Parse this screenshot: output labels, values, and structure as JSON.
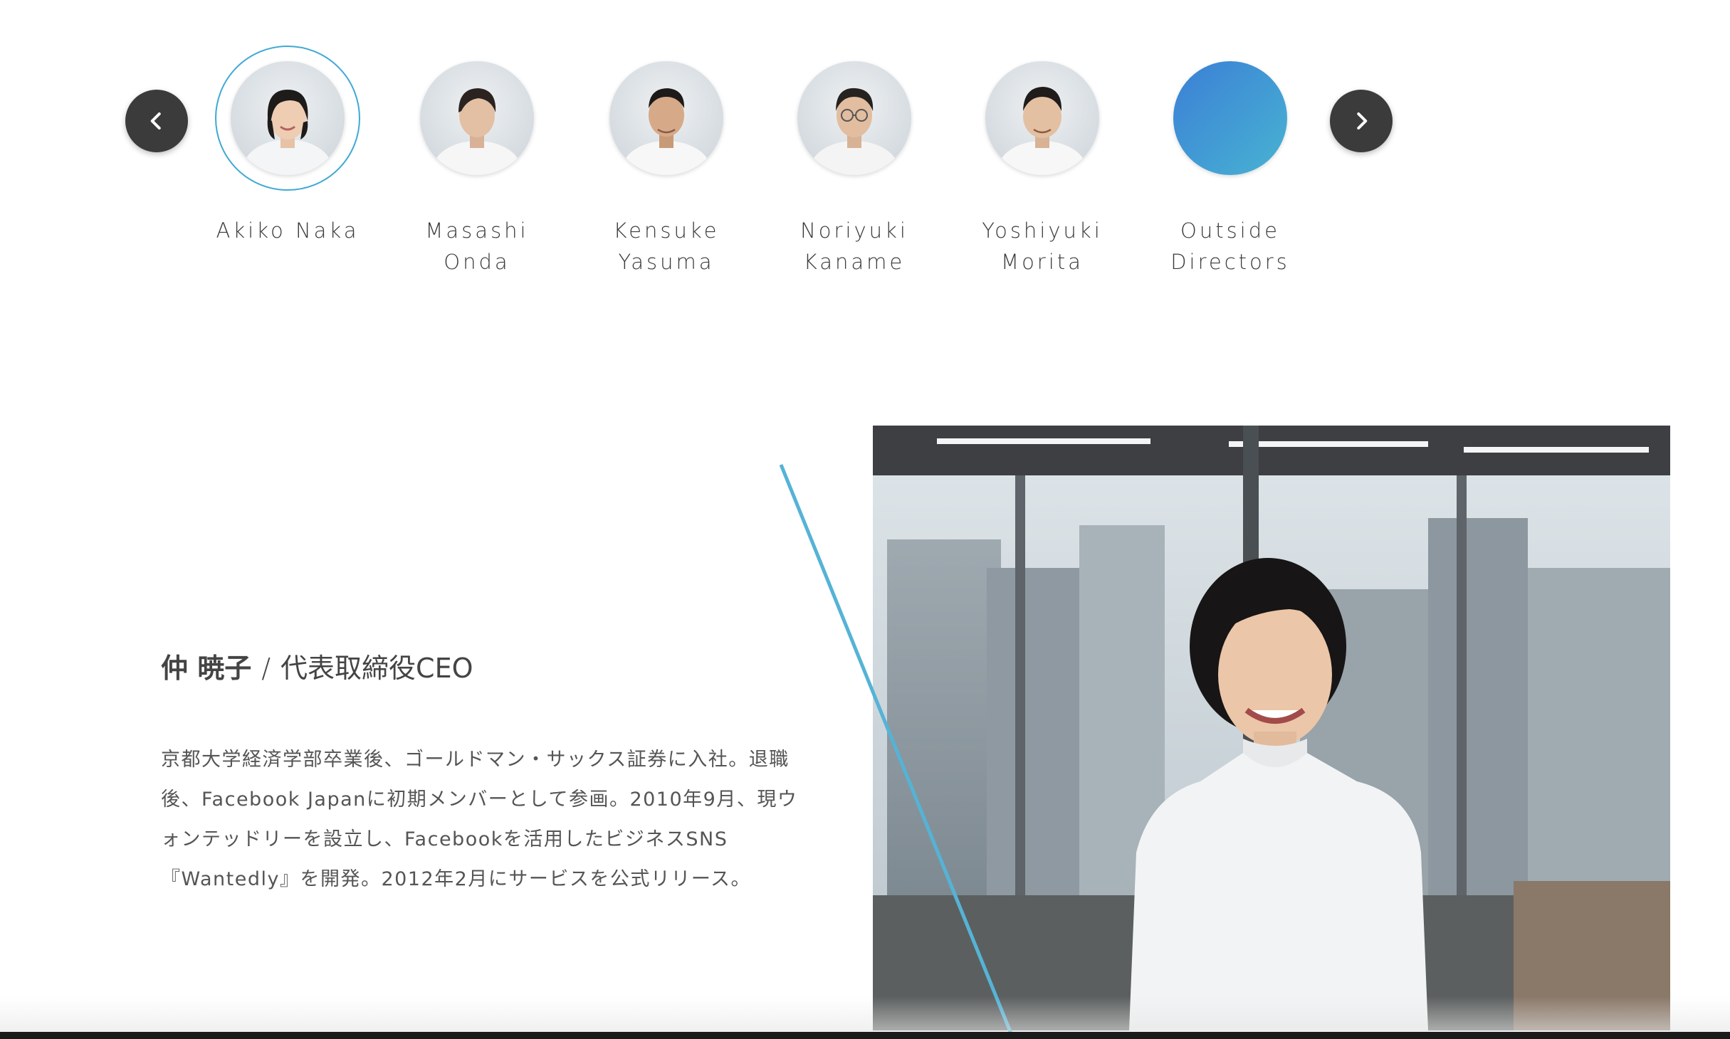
{
  "carousel": {
    "prev_icon": "chevron-left-icon",
    "next_icon": "chevron-right-icon",
    "members": [
      {
        "name": "Akiko Naka",
        "active": true
      },
      {
        "name": "Masashi\nOnda",
        "active": false
      },
      {
        "name": "Kensuke\nYasuma",
        "active": false
      },
      {
        "name": "Noriyuki\nKaname",
        "active": false
      },
      {
        "name": "Yoshiyuki\nMorita",
        "active": false
      },
      {
        "name": "Outside\nDirectors",
        "active": false
      }
    ]
  },
  "profile": {
    "name_jp": "仲 暁子",
    "separator": "/",
    "role": "代表取締役CEO",
    "bio": "京都大学経済学部卒業後、ゴールドマン・サックス証券に入社。退職後、Facebook Japanに初期メンバーとして参画。2010年9月、現ウォンテッドリーを設立し、Facebookを活用したビジネスSNS『Wantedly』を開発。2012年2月にサービスを公式リリース。"
  },
  "colors": {
    "accent": "#3fa9d4",
    "nav_button": "#3b3b3b",
    "gradient_start": "#3b7fd6",
    "gradient_end": "#48b3d2"
  }
}
